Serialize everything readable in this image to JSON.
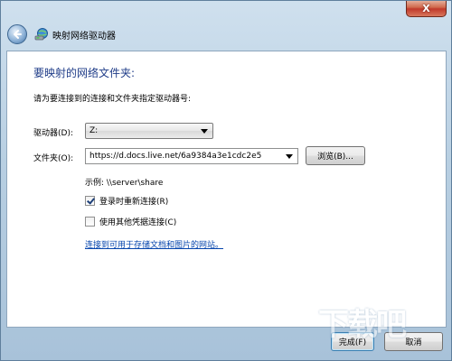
{
  "window": {
    "title": "映射网络驱动器",
    "close_glyph": "X"
  },
  "main": {
    "heading": "要映射的网络文件夹:",
    "description": "请为要连接到的连接和文件夹指定驱动器号:",
    "drive_label": "驱动器(D):",
    "drive_value": "Z:",
    "folder_label": "文件夹(O):",
    "folder_value": "https://d.docs.live.net/6a9384a3e1cdc2e5",
    "browse_label": "浏览(B)...",
    "example_text": "示例: \\\\server\\share",
    "reconnect_label": "登录时重新连接(R)",
    "reconnect_checked": true,
    "other_credentials_label": "使用其他凭据连接(C)",
    "other_credentials_checked": false,
    "link_text": "连接到可用于存储文档和图片的网站。"
  },
  "footer": {
    "finish_label": "完成(F)",
    "cancel_label": "取消"
  },
  "watermark": {
    "text": "下载吧"
  },
  "colors": {
    "heading": "#1f3c88",
    "link": "#0645ad",
    "close_button": "#c0392b"
  },
  "icons": [
    "back-arrow-icon",
    "network-drive-icon",
    "close-icon",
    "chevron-down-icon",
    "checkmark-icon"
  ]
}
